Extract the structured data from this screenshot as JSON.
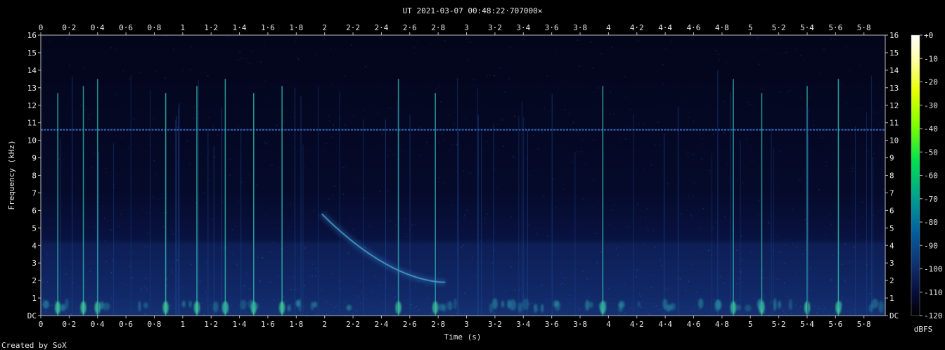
{
  "chart_data": {
    "type": "heatmap",
    "title": "UT 2021-03-07 00:48:22·707000×",
    "xlabel": "Time (s)",
    "ylabel": "Frequency (kHz)",
    "xlim": [
      0,
      5.95
    ],
    "ylim": [
      0,
      16
    ],
    "x_ticks": [
      "0",
      "0·2",
      "0·4",
      "0·6",
      "0·8",
      "1",
      "1·2",
      "1·4",
      "1·6",
      "1·8",
      "2",
      "2·2",
      "2·4",
      "2·6",
      "2·8",
      "3",
      "3·2",
      "3·4",
      "3·6",
      "3·8",
      "4",
      "4·2",
      "4·4",
      "4·6",
      "4·8",
      "5",
      "5·2",
      "5·4",
      "5·6",
      "5·8"
    ],
    "x_tick_values": [
      0,
      0.2,
      0.4,
      0.6,
      0.8,
      1,
      1.2,
      1.4,
      1.6,
      1.8,
      2,
      2.2,
      2.4,
      2.6,
      2.8,
      3,
      3.2,
      3.4,
      3.6,
      3.8,
      4,
      4.2,
      4.4,
      4.6,
      4.8,
      5,
      5.2,
      5.4,
      5.6,
      5.8
    ],
    "y_ticks": [
      "DC",
      "1",
      "2",
      "3",
      "4",
      "5",
      "6",
      "7",
      "8",
      "9",
      "10",
      "11",
      "12",
      "13",
      "14",
      "15",
      "16"
    ],
    "y_tick_values": [
      0,
      1,
      2,
      3,
      4,
      5,
      6,
      7,
      8,
      9,
      10,
      11,
      12,
      13,
      14,
      15,
      16
    ],
    "colorbar": {
      "label": "dBFS",
      "ticks": [
        "+0",
        "-10",
        "-20",
        "-30",
        "-40",
        "-50",
        "-60",
        "-70",
        "-80",
        "-90",
        "-100",
        "-110",
        "-120"
      ],
      "tick_values": [
        0,
        -10,
        -20,
        -30,
        -40,
        -50,
        -60,
        -70,
        -80,
        -90,
        -100,
        -110,
        -120
      ],
      "range": [
        -120,
        0
      ]
    },
    "features": {
      "tone_line_khz": 10.6,
      "impulses_s": [
        0.12,
        0.3,
        0.4,
        0.88,
        1.1,
        1.3,
        1.5,
        1.7,
        2.52,
        2.78,
        3.96,
        4.88,
        5.08,
        5.4,
        5.62
      ],
      "dispersive_whistler": {
        "start_s": 1.98,
        "end_s": 2.85,
        "start_khz": 5.8,
        "end_khz": 1.9
      },
      "background_band_khz": [
        0,
        4.2
      ]
    },
    "colors": {
      "background": "#000000",
      "text": "#e8e8e8",
      "plot_bg": "#060b2a"
    }
  },
  "footer": {
    "credit": "Created by SoX"
  }
}
